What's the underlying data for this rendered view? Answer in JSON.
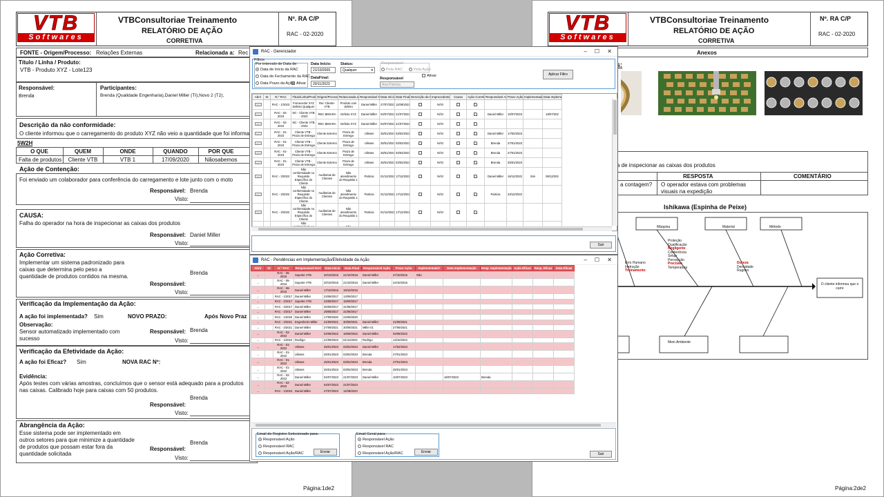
{
  "page1": {
    "company": "VTBConsultoriae Treinamento",
    "report_title": "RELATÓRIO DE AÇÃO",
    "report_sub": "CORRETIVA",
    "num_label": "Nº. RA C/P",
    "num_value": "RAC - 02-2020",
    "logo_big": "VTB",
    "logo_small": "Softwares",
    "fonte_label": "FONTE - Origem/Processo:",
    "fonte_value": "Relações Externas",
    "relacionada_label": "Relacionada a:",
    "relacionada_value": "Rec",
    "titulo_label": "Título / Linha / Produto:",
    "titulo_value": "VTB - Produto XYZ - Lote123",
    "responsavel_label": "Responsável:",
    "responsavel_value": "Brenda",
    "participantes_label": "Participantes:",
    "participantes_value": "Brenda (Qualidade Engenharia),Daniel Miller (TI),Novo 2 (T2),",
    "descricao_label": "Descrição da não conformidade:",
    "descricao_value": "O cliente informou que o carregamento do produto XYZ não veio a quantidade que foi informada",
    "w5h2": "5W2H",
    "w_headers": [
      "O QUE",
      "QUEM",
      "ONDE",
      "QUANDO",
      "POR QUE"
    ],
    "w_values": [
      "Falta de produtos",
      "Cliente VTB",
      "VTB 1",
      "17/09/2020",
      "Nãosabemos"
    ],
    "contencao_label": "Ação de Contenção:",
    "contencao_value": "Foi enviado um colaborador para conferência do carregamento e lote junto com o moto",
    "resp_label": "Responsável:",
    "visto_label": "Visto:",
    "contencao_resp": "Brenda",
    "causa_label": "CAUSA:",
    "causa_value": "Falha do operador na hora de inspecionar as caixas dos produtos",
    "causa_resp": "Daniel Miller",
    "corretiva_label": "Ação Corretiva:",
    "corretiva_value": "Implementar um sistema padronizado para caixas que determina pelo peso a quantidade de produtos contidos na mesma.",
    "corretiva_resp": "Brenda",
    "verif_impl_label": "Verificação da Implementação da Ação:",
    "impl_q": "A ação foi implementada?",
    "impl_a": "Sim",
    "novo_prazo": "NOVO PRAZO:",
    "apos_novo": "Após Novo Praz",
    "obs_label": "Observação:",
    "obs_value": "Sensor automatizado implementado com sucesso",
    "impl_resp": "Brenda",
    "verif_efet_label": "Verificação da Efetividade da Ação:",
    "efic_q": "A ação foi Eficaz?",
    "efic_a": "Sim",
    "nova_rac": "NOVA RAC Nº:",
    "evid_label": "Evidência:",
    "evid_value": "Após testes com várias amostras, concluímos que o sensor está adequado para a produtos nas caixas. Calibrado hoje para caixas com 50 produtos.",
    "efet_resp": "Brenda",
    "abrang_label": "Abrangência da Ação:",
    "abrang_value": "Esse sistema pode ser implementado em outros setores para que minimize a quantidade de produtos que possam estar fora da quantidade solicitada",
    "abrang_resp": "Brenda",
    "pagina": "Página:1de2"
  },
  "page2": {
    "company": "VTBConsultoriae Treinamento",
    "report_title": "RELATÓRIO DE AÇÃO",
    "report_sub": "CORRETIVA",
    "num_label": "Nº. RA C/P",
    "num_value": "RAC - 02-2020",
    "anexos": "Anexos",
    "anexos_colon": "s:",
    "inspec_text": "a de inspecionar as caixas dos produtos",
    "resposta_h": "RESPOSTA",
    "comentario_h": "COMENTÁRIO",
    "pergunta": "a contagem?",
    "resposta": "O operador estava com problemas visuais na expedição",
    "ishikawa_title": "Ishikawa (Espinha de Peixe)",
    "ish_top": [
      "Máquina",
      "Material",
      "Método"
    ],
    "ish_cause_1": [
      "Proteção",
      "Qualificação",
      "Negligente",
      "Conferência",
      "Setup",
      "Percepção",
      "Precisão",
      "Temperatura"
    ],
    "ish_cause_2": [
      "Erro Humano",
      "Instrução",
      "Treinamento"
    ],
    "ish_cause_3": [
      "Dureza",
      "Densidade",
      "Rugoso"
    ],
    "ish_effect": "O cliente informou que o carre",
    "ish_bottom": "Meio Ambiente",
    "pagina": "Página:2de2"
  },
  "gerenciador": {
    "title": "RAC - Gerenciador",
    "filtros": "Filtros",
    "por_intervalo": "Por intervalo de Data de:",
    "opt_inicio": "Data de Início da RAC",
    "opt_fechamento": "Data de Fechamento da RAC",
    "opt_prazo": "Data Prazo da Ação",
    "ativar": "Ativar",
    "data_inicio_label": "Data Início:",
    "data_inicio": "21/10/2009",
    "data_final_label": "DataFinal:",
    "data_final": "20/11/2023",
    "status_label": "Status:",
    "status": "Qualquer",
    "responsavel_grp": "Responsável",
    "pela_rac": "Pela RAC",
    "pela_acao": "Pela Ação",
    "ativar2": "Ativar",
    "responsavel_label": "Responsável",
    "responsavel_val": "Ana Patricia",
    "aplicar": "Aplicar Filtro",
    "sair": "Sair",
    "columns": [
      "Abrir",
      "St",
      "N.º RAC",
      "Título/Linha/Produto",
      "Origem/Processo",
      "Relacionada a",
      "Responsável RAC",
      "Data Início",
      "Data Final",
      "Descrição da NC",
      "Improcedente?",
      "Causa",
      "Ação Corretiva",
      "Responsável Ação",
      "Prazo Ação",
      "Implementada?",
      "Data Impleme"
    ],
    "rows": [
      [
        "...",
        "",
        "RAC - 1/2023",
        "Fornecedor XYZ Defeito Qualquer",
        "Rec Cliente-VTB",
        "Produto com defeito",
        "Daniel Miller",
        "27/07/2023",
        "11/08/2023",
        "",
        "NÃO",
        "",
        "",
        "",
        "",
        "",
        ""
      ],
      [
        "...",
        "",
        "RAC - 02-2023",
        "NC - Cliente VTB - 2023",
        "REC BIMARA",
        "Defeito XYZ",
        "Daniel Miller",
        "04/07/2023",
        "21/07/2023",
        "",
        "NÃO",
        "",
        "",
        "Daniel Miller",
        "10/07/2023",
        "",
        "18/07/202"
      ],
      [
        "...",
        "",
        "RAC - 02-2023",
        "NC - Cliente VTB - 2023",
        "REC BIMARA",
        "Defeito XYZ",
        "Daniel Miller",
        "04/07/2023",
        "21/07/2023",
        "",
        "NÃO",
        "",
        "",
        "",
        "",
        "",
        ""
      ],
      [
        "...",
        "",
        "RAC - 01-2023",
        "Cliente VTB - Prazo de Entrega",
        "Cliente Externo",
        "Prazo de Entrega",
        "Ulisses",
        "25/01/2023",
        "03/02/2023",
        "",
        "NÃO",
        "",
        "",
        "Daniel Miller",
        "17/02/2023",
        "",
        ""
      ],
      [
        "...",
        "",
        "RAC - 01-2023",
        "Cliente VTB - Prazo de Entrega",
        "Cliente Externo",
        "Prazo de Entrega",
        "Ulisses",
        "25/01/2023",
        "03/02/2023",
        "",
        "NÃO",
        "",
        "",
        "Brenda",
        "27/01/2023",
        "",
        ""
      ],
      [
        "...",
        "",
        "RAC - 01-2023",
        "Cliente VTB - Prazo de Entrega",
        "Cliente Externo",
        "Prazo de Entrega",
        "Ulisses",
        "25/01/2023",
        "03/02/2023",
        "",
        "NÃO",
        "",
        "",
        "Brenda",
        "27/01/2023",
        "",
        ""
      ],
      [
        "...",
        "",
        "RAC - 01-2023",
        "Cliente VTB - Prazo de Entrega",
        "Cliente Externo",
        "Prazo de Entrega",
        "Ulisses",
        "25/01/2023",
        "03/02/2023",
        "",
        "NÃO",
        "",
        "",
        "Brenda",
        "25/01/2023",
        "",
        ""
      ],
      [
        "...",
        "",
        "RAC - 3/2022",
        "Não conformidade no Requisito Específico do Cliente",
        "Auditorias de Clientes",
        "Não atendimento do Requisito 1",
        "Patricia",
        "01/12/2022",
        "17/12/2022",
        "",
        "NÃO",
        "",
        "",
        "Daniel Miller",
        "15/12/2022",
        "Sim",
        "08/12/202"
      ],
      [
        "...",
        "",
        "RAC - 3/2022",
        "Não conformidade no Requisito Específico do Cliente",
        "Auditorias de Clientes",
        "Não atendimento do Requisito 1",
        "Patricia",
        "01/12/2022",
        "17/12/2022",
        "",
        "NÃO",
        "",
        "",
        "Patricia",
        "23/12/2022",
        "",
        ""
      ],
      [
        "...",
        "",
        "RAC - 3/2022",
        "Não conformidade no Requisito Específico do Cliente",
        "Auditorias de Clientes",
        "Não atendimento do Requisito 1",
        "Patricia",
        "01/12/2022",
        "17/12/2022",
        "",
        "NÃO",
        "",
        "",
        "",
        "",
        "",
        ""
      ],
      [
        "...",
        "",
        "RAC - 3/2022",
        "Não conformidade no Requisito Específico do Cliente",
        "Auditorias de Clientes",
        "Não atendimento do Requisito 1",
        "Patricia",
        "01/12/2022",
        "17/12/2022",
        "",
        "NÃO",
        "",
        "",
        "",
        "",
        "",
        ""
      ],
      [
        "...",
        "",
        "RAC - 2/2022",
        "Cliente VTB - Defeito na Embalagem",
        "Cliente Externo",
        "Defeito na Embalagem",
        "Mauricio",
        "10/11/2022",
        "24/11/2022",
        "",
        "NÃO",
        "",
        "",
        "Rodrigo",
        "25/11/2022",
        "Sim",
        "14/11/202"
      ],
      [
        "...",
        "",
        "RAC - 1/2022",
        "Defeito Produto XYZ com defeito A",
        "Cliente Externo",
        "Produto com defeito tipo A",
        "Rodrigo",
        "21/09/2022",
        "01/11/2022",
        "",
        "NÃO",
        "",
        "",
        "Rodrigo",
        "13/10/2022",
        "",
        ""
      ]
    ]
  },
  "pendencias": {
    "title": "RAC - Pendências em Implementação/Efetividade da Ação",
    "columns": [
      "Abrir",
      "St",
      "N.º RAC",
      "Responsável RAC",
      "Data Início",
      "Data Final",
      "Responsável Ação",
      "Prazo Ação",
      "Implementada?",
      "Data Implementação",
      "Resp. Implementação",
      "Ação Eficaz",
      "Resp. Eficaz",
      "Data Eficaz"
    ],
    "rows": [
      {
        "c": [
          "...",
          "",
          "RAC - 05-2016",
          "Suporte VTB",
          "20/10/2016",
          "21/10/2016",
          "Daniel Miller",
          "27/10/2016",
          "Não",
          "",
          "",
          "",
          "",
          ""
        ],
        "style": "pink"
      },
      {
        "c": [
          "...",
          "",
          "RAC - 05-2016",
          "Suporte VTB",
          "20/10/2016",
          "21/10/2016",
          "Daniel Miller",
          "24/10/2016",
          "",
          "",
          "",
          "",
          "",
          ""
        ],
        "style": "white"
      },
      {
        "c": [
          "...",
          "",
          "RAC - 06-2016",
          "Daniel Miller",
          "17/10/2016",
          "19/10/2016",
          "",
          "",
          "",
          "",
          "",
          "",
          "",
          ""
        ],
        "style": "pink"
      },
      {
        "c": [
          "...",
          "",
          "RAC - 1/2017",
          "Daniel Miller",
          "23/08/2017",
          "13/09/2017",
          "",
          "",
          "",
          "",
          "",
          "",
          "",
          ""
        ],
        "style": "white"
      },
      {
        "c": [
          "...",
          "",
          "RAC - 2/2017",
          "Suporte VTB",
          "24/08/2017",
          "15/09/2017",
          "",
          "",
          "",
          "",
          "",
          "",
          "",
          ""
        ],
        "style": "pink"
      },
      {
        "c": [
          "...",
          "",
          "RAC - 3/2017",
          "Daniel Miller",
          "25/08/2017",
          "31/08/2017",
          "",
          "",
          "",
          "",
          "",
          "",
          "",
          ""
        ],
        "style": "white"
      },
      {
        "c": [
          "...",
          "",
          "RAC - 4/2017",
          "Daniel Miller",
          "29/08/2017",
          "31/08/2017",
          "",
          "",
          "",
          "",
          "",
          "",
          "",
          ""
        ],
        "style": "pink"
      },
      {
        "c": [
          "...",
          "",
          "RAC - 1/2020",
          "Daniel Miller",
          "17/09/2020",
          "24/09/2020",
          "",
          "",
          "",
          "",
          "",
          "",
          "",
          ""
        ],
        "style": "white"
      },
      {
        "c": [
          "...",
          "",
          "RAC - 2/2021",
          "Engenheiro Miller",
          "21/09/2021",
          "30/09/2021",
          "Daniel Miller",
          "21/09/2021",
          "",
          "",
          "",
          "",
          "",
          ""
        ],
        "style": "pink"
      },
      {
        "c": [
          "...",
          "",
          "RAC - 3/2021",
          "Daniel Miller",
          "27/09/2021",
          "30/09/2021",
          "Miller 01",
          "27/09/2021",
          "",
          "",
          "",
          "",
          "",
          ""
        ],
        "style": "white"
      },
      {
        "c": [
          "...",
          "",
          "RAC - 02-2022",
          "Daniel Miller",
          "04/08/2022",
          "18/08/2022",
          "Daniel Miller",
          "04/08/2022",
          "",
          "",
          "",
          "",
          "",
          ""
        ],
        "style": "pink"
      },
      {
        "c": [
          "...",
          "",
          "RAC - 1/2022",
          "Rodrigo",
          "21/09/2022",
          "01/11/2022",
          "Rodrigo",
          "13/10/2022",
          "",
          "",
          "",
          "",
          "",
          ""
        ],
        "style": "white"
      },
      {
        "c": [
          "...",
          "",
          "RAC - 01-2022",
          "Ulisses",
          "25/01/2023",
          "03/02/2023",
          "Daniel Miller",
          "17/02/2023",
          "",
          "",
          "",
          "",
          "",
          ""
        ],
        "style": "pink"
      },
      {
        "c": [
          "...",
          "",
          "RAC - 01-2022",
          "Ulisses",
          "25/01/2023",
          "03/02/2023",
          "Brenda",
          "27/01/2023",
          "",
          "",
          "",
          "",
          "",
          ""
        ],
        "style": "white"
      },
      {
        "c": [
          "...",
          "",
          "RAC - 01-2022",
          "Ulisses",
          "25/01/2023",
          "03/02/2023",
          "Brenda",
          "27/01/2023",
          "",
          "",
          "",
          "",
          "",
          ""
        ],
        "style": "pink"
      },
      {
        "c": [
          "...",
          "",
          "RAC - 01-2022",
          "Ulisses",
          "25/01/2023",
          "03/02/2023",
          "Brenda",
          "25/01/2023",
          "",
          "",
          "",
          "",
          "",
          ""
        ],
        "style": "white"
      },
      {
        "c": [
          "...",
          "",
          "RAC - 02-2022",
          "Daniel Miller",
          "04/07/2023",
          "21/07/2023",
          "Daniel Miller",
          "10/07/2023",
          "",
          "18/07/2023",
          "Brenda",
          "",
          "",
          ""
        ],
        "style": "white"
      },
      {
        "c": [
          "...",
          "",
          "RAC - 02-2022",
          "Daniel Miller",
          "04/07/2023",
          "21/07/2023",
          "",
          "",
          "",
          "",
          "",
          "",
          "",
          ""
        ],
        "style": "pink"
      },
      {
        "c": [
          "...",
          "",
          "RAC - 1/2023",
          "Daniel Miller",
          "27/07/2023",
          "11/08/2023",
          "",
          "",
          "",
          "",
          "",
          "",
          "",
          ""
        ],
        "style": "pink"
      }
    ],
    "email_reg_label": "Email do Registro Selecionado para:",
    "email_geral_label": "Email Geral para:",
    "opt_resp_acao": "Responsável Ação",
    "opt_resp_rac": "Responsável RAC",
    "opt_resp_acao_rac": "Responsável Ação/RAC",
    "enviar": "Enviar",
    "sair": "Sair"
  }
}
